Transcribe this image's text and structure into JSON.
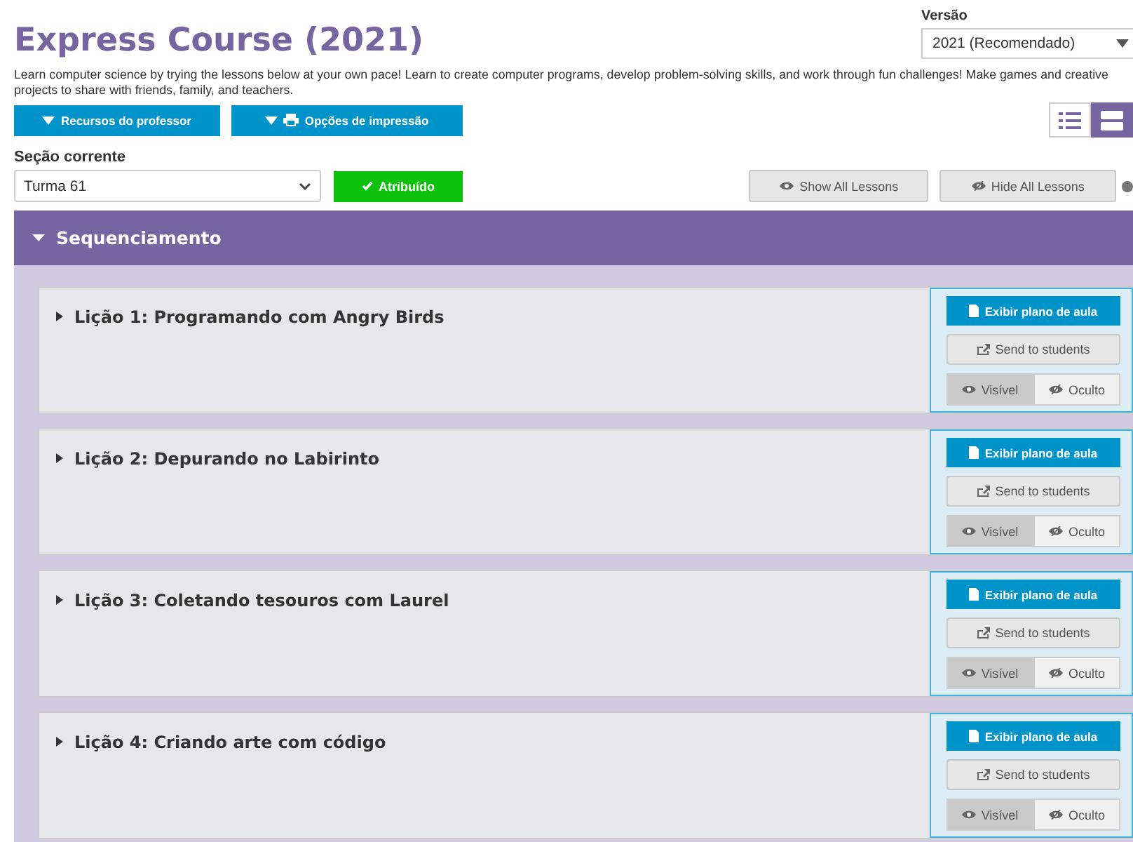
{
  "header": {
    "title": "Express Course (2021)",
    "version_label": "Versão",
    "version_value": "2021 (Recomendado)",
    "description": "Learn computer science by trying the lessons below at your own pace! Learn to create computer programs, develop problem-solving skills, and work through fun challenges! Make games and creative projects to share with friends, family, and teachers."
  },
  "actions": [
    "Recursos do professor",
    "Opções de impressão"
  ],
  "view_toggle": [
    {
      "kind": "list",
      "selected": false
    },
    {
      "kind": "detail",
      "selected": true
    }
  ],
  "section": {
    "label": "Seção corrente",
    "value": "Turma 61",
    "assigned": "Atribuído",
    "show_all": "Show All Lessons",
    "hide_all": "Hide All Lessons"
  },
  "unit": {
    "title": "Sequenciamento",
    "expanded": true
  },
  "lessons": [
    {
      "title": "Lição 1: Programando com Angry Birds",
      "plan": "Exibir plano de aula",
      "send": "Send to students",
      "visibility": [
        {
          "label": "Visível",
          "selected": true
        },
        {
          "label": "Oculto",
          "selected": false
        }
      ]
    },
    {
      "title": "Lição 2: Depurando no Labirinto",
      "plan": "Exibir plano de aula",
      "send": "Send to students",
      "visibility": [
        {
          "label": "Visível",
          "selected": true
        },
        {
          "label": "Oculto",
          "selected": false
        }
      ]
    },
    {
      "title": "Lição 3: Coletando tesouros com Laurel",
      "plan": "Exibir plano de aula",
      "send": "Send to students",
      "visibility": [
        {
          "label": "Visível",
          "selected": true
        },
        {
          "label": "Oculto",
          "selected": false
        }
      ]
    },
    {
      "title": "Lição 4: Criando arte com código",
      "plan": "Exibir plano de aula",
      "send": "Send to students",
      "visibility": [
        {
          "label": "Visível",
          "selected": true
        },
        {
          "label": "Oculto",
          "selected": false
        }
      ]
    }
  ]
}
